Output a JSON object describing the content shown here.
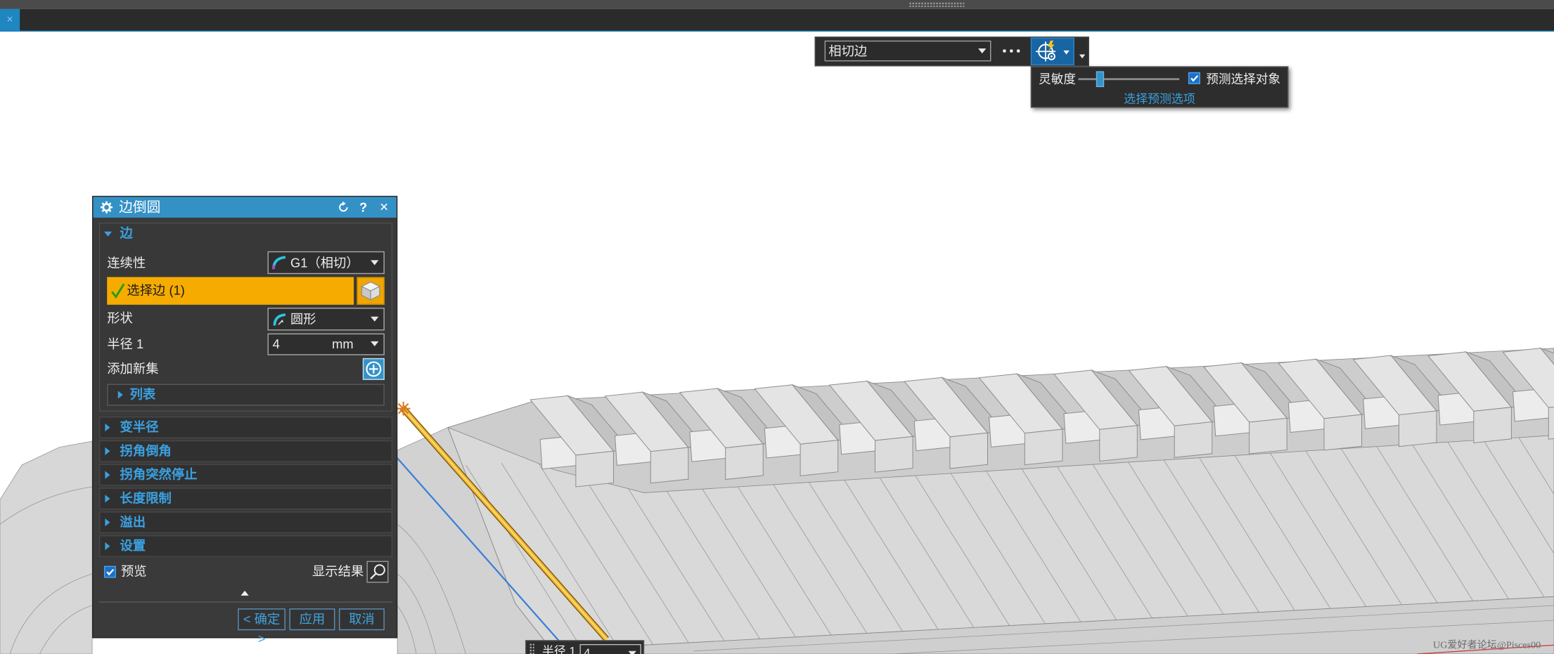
{
  "window": {
    "tab_close": "×"
  },
  "selection_bar": {
    "type_filter_value": "相切边",
    "more_icon": "more-dots-icon",
    "selection_mode_icon": "selection-intent-icon"
  },
  "prediction_popup": {
    "sensitivity_label": "灵敏度",
    "sensitivity_level": 0.22,
    "predict_label": "预测选择对象",
    "predict_checked": true,
    "options_link": "选择预测选项"
  },
  "dialog": {
    "title": "边倒圆",
    "header_icons": {
      "settings": "gear-icon",
      "reset": "reset-icon",
      "help": "?",
      "close": "×"
    },
    "edge_section": {
      "label": "边",
      "continuity_label": "连续性",
      "continuity_value": "G1（相切）",
      "select_edge_label": "选择边 (1)",
      "shape_label": "形状",
      "shape_value": "圆形",
      "radius_label": "半径 1",
      "radius_value": "4",
      "radius_unit": "mm",
      "add_set_label": "添加新集",
      "list_label": "列表"
    },
    "sections": [
      "变半径",
      "拐角倒角",
      "拐角突然停止",
      "长度限制",
      "溢出",
      "设置"
    ],
    "preview_label": "预览",
    "preview_checked": true,
    "show_result_label": "显示结果",
    "buttons": {
      "ok": "< 确定 >",
      "apply": "应用",
      "cancel": "取消"
    }
  },
  "radius_handle": {
    "label": "半径 1",
    "value": "4"
  },
  "watermark": "UG爱好者论坛@Pisces00",
  "colors": {
    "accent": "#3391c6",
    "selection_highlight": "#f5ab00",
    "edge_highlight": "#f2b632",
    "link": "#3aa0e0"
  }
}
